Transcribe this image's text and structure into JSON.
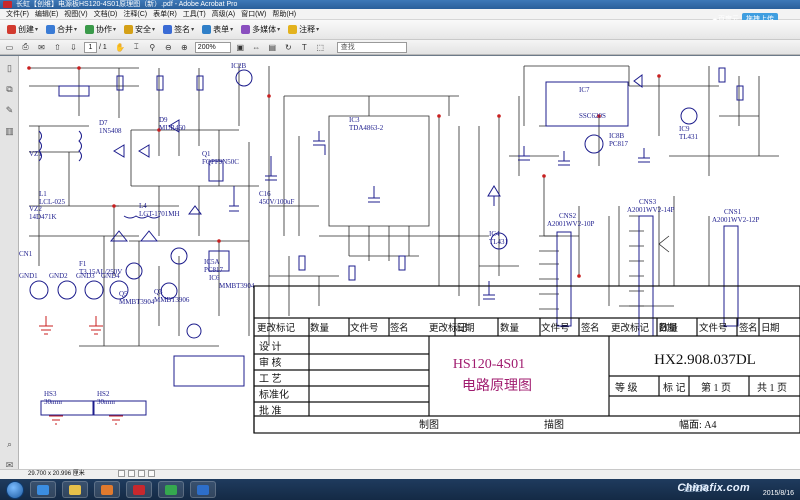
{
  "window": {
    "title": "长虹【创维】电源板HS120-4S01原理图（新）.pdf - Adobe Acrobat Pro"
  },
  "menu": [
    "文件(F)",
    "编辑(E)",
    "视图(V)",
    "文档(D)",
    "注释(C)",
    "表单(R)",
    "工具(T)",
    "高级(A)",
    "窗口(W)",
    "帮助(H)"
  ],
  "cloud": {
    "label": "百度云",
    "button": "拖拽上传"
  },
  "toolbar": [
    {
      "label": "创建",
      "icon": "create-pdf-icon",
      "color": "#d23a2f"
    },
    {
      "label": "合并",
      "icon": "combine-icon",
      "color": "#3a7bd5"
    },
    {
      "label": "协作",
      "icon": "collaborate-icon",
      "color": "#3a9a4a"
    },
    {
      "label": "安全",
      "icon": "lock-icon",
      "color": "#d4a017"
    },
    {
      "label": "签名",
      "icon": "pen-icon",
      "color": "#3a6bd5"
    },
    {
      "label": "表单",
      "icon": "form-icon",
      "color": "#2f7fc8"
    },
    {
      "label": "多媒体",
      "icon": "multimedia-icon",
      "color": "#8a4fbf"
    },
    {
      "label": "注释",
      "icon": "comment-icon",
      "color": "#e3b21d"
    }
  ],
  "nav": {
    "page": "1",
    "total": "/ 1",
    "zoom": "200%",
    "search_placeholder": "查找"
  },
  "status": {
    "size": "29.700 x 20.996 厘米"
  },
  "tray": {
    "time": "",
    "date": "2015/8/16"
  },
  "watermark": {
    "text": "Chinafix.com",
    "sub": "迅维网"
  },
  "schematic": {
    "model": "HS120-4S01",
    "name": "电路原理图",
    "code": "HX2.908.037DL",
    "rev_header": [
      "更改标记",
      "数量",
      "文件号",
      "签",
      "名",
      "日",
      "期"
    ],
    "roles": [
      "设 计",
      "审 核",
      "工 艺",
      "标准化",
      "批 准"
    ],
    "grade": [
      "等 级",
      "标 记",
      "第 1 页",
      "共 1 页"
    ],
    "bottom": [
      "制图",
      "描图",
      "幅面: A4"
    ],
    "connectors": [
      {
        "name": "CNS2",
        "part": "A2001WV2-10P"
      },
      {
        "name": "CNS3",
        "part": "A2001WV2-14P"
      },
      {
        "name": "CNS1",
        "part": "A2001WV2-12P"
      }
    ],
    "parts": [
      "IC7",
      "SSC620S",
      "IC8B",
      "PC817",
      "IC9",
      "TL431",
      "IC2B",
      "IC3",
      "TDA4863-2",
      "IC4",
      "TL431",
      "IC5A",
      "PC817",
      "IC6",
      "MMBT3904",
      "D7",
      "1N5408",
      "D9",
      "MUR460",
      "L4",
      "LGT-1701MH",
      "Q1",
      "FQPF9N50C",
      "C16",
      "450V/100uF",
      "Q3",
      "MMBT3906",
      "Q5",
      "MMBT3904",
      "VZ1",
      "VZ2",
      "14D471K",
      "F1",
      "T3.15AL/250V",
      "L1",
      "LCL-025",
      "HS3",
      "30mm",
      "HS2",
      "30mm",
      "GND1",
      "GND2",
      "GND3",
      "GND4",
      "CN1"
    ]
  },
  "colors": {
    "line": "#1c1c8c",
    "wire": "#2a2a2a",
    "accent": "#a01c6f",
    "red": "#c81f1f"
  }
}
